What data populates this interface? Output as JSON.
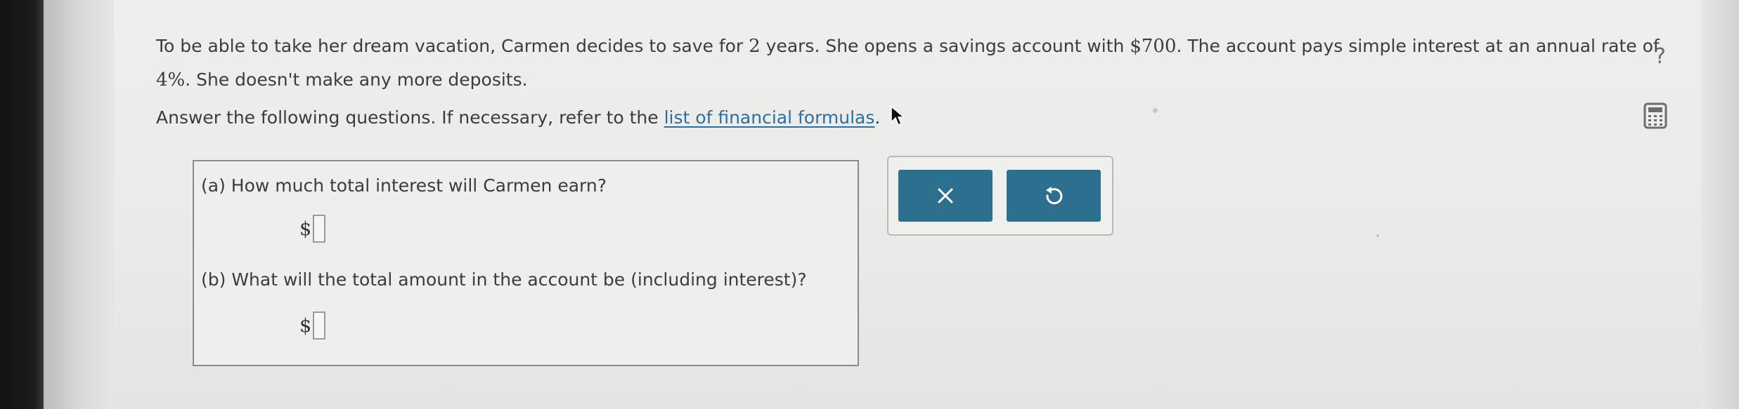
{
  "problem": {
    "seg1": "To be able to take her dream vacation, Carmen decides to save for ",
    "years": "2",
    "seg2": " years. She opens a savings account with ",
    "principal": "$700",
    "seg3": ". The account pays simple interest at an annual rate of ",
    "rate": "4%",
    "seg4": ". She doesn't make any more deposits."
  },
  "instructions": {
    "text": "Answer the following questions. If necessary, refer to the ",
    "link_text": "list of financial formulas",
    "period": "."
  },
  "questions": {
    "a": {
      "label": "(a) How much total interest will Carmen earn?",
      "currency": "$",
      "value": ""
    },
    "b": {
      "label": "(b) What will the total amount in the account be (including interest)?",
      "currency": "$",
      "value": ""
    }
  },
  "buttons": {
    "clear_icon": "close-icon",
    "undo_icon": "undo-icon",
    "accent_color": "#2d6f8e"
  },
  "toolbar": {
    "help_label": "?",
    "help_icon": "question-icon",
    "calc_icon": "calculator-icon"
  },
  "colors": {
    "link": "#2f6fa0",
    "text": "#3c3c3c",
    "background": "#ececea"
  }
}
